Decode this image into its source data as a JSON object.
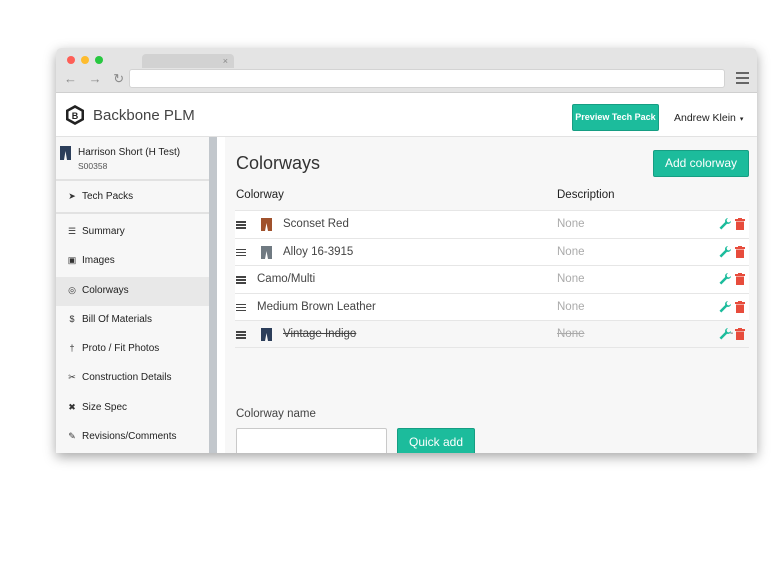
{
  "browser": {
    "tab_close": "×",
    "nav_arrows": "← → ↻"
  },
  "header": {
    "brand": "Backbone PLM",
    "preview_button": "Preview Tech Pack",
    "user_name": "Andrew Klein",
    "user_caret": "▾"
  },
  "sidebar": {
    "product_name": "Harrison Short (H Test)",
    "product_code": "S00358",
    "tech_packs_label": "Tech Packs",
    "items": [
      {
        "label": "Summary",
        "icon": "☰"
      },
      {
        "label": "Images",
        "icon": "▣"
      },
      {
        "label": "Colorways",
        "icon": "◎"
      },
      {
        "label": "Bill Of Materials",
        "icon": "$"
      },
      {
        "label": "Proto / Fit Photos",
        "icon": "†"
      },
      {
        "label": "Construction Details",
        "icon": "✂"
      },
      {
        "label": "Size Spec",
        "icon": "✖"
      },
      {
        "label": "Revisions/Comments",
        "icon": "✎"
      }
    ],
    "active_item": "Colorways"
  },
  "main": {
    "title": "Colorways",
    "add_button": "Add colorway",
    "col_colorway": "Colorway",
    "col_description": "Description",
    "rows": [
      {
        "name": "Sconset Red",
        "description": "None",
        "swatch": "#a0522d"
      },
      {
        "name": "Alloy 16-3915",
        "description": "None",
        "swatch": "#707a82"
      },
      {
        "name": "Camo/Multi",
        "description": "None"
      },
      {
        "name": "Medium Brown Leather",
        "description": "None"
      },
      {
        "name": "Vintage Indigo",
        "description": "None",
        "swatch": "#2c3e5a"
      }
    ],
    "form_label": "Colorway name",
    "input_value": "",
    "quick_add_button": "Quick add",
    "last_row_dash": "-"
  },
  "colors": {
    "accent": "#1cbc9c",
    "edit_icon": "#1cbc9c",
    "delete_icon": "#e74c3c"
  }
}
